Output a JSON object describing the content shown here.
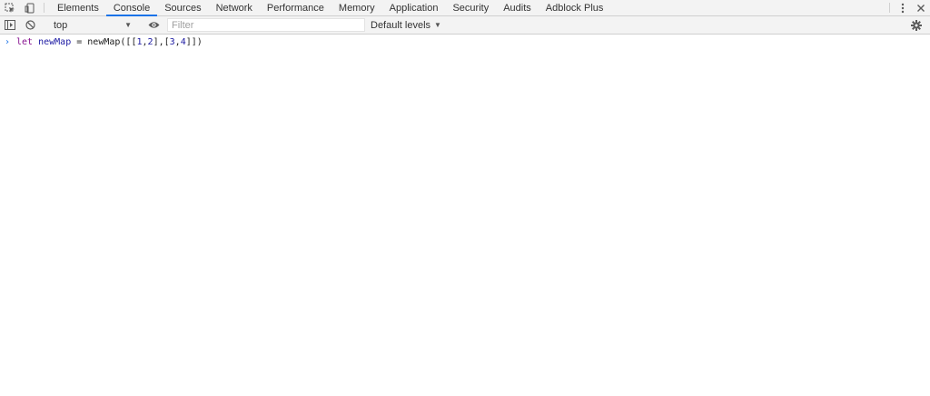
{
  "tabbar": {
    "tabs": [
      {
        "label": "Elements",
        "active": false
      },
      {
        "label": "Console",
        "active": true
      },
      {
        "label": "Sources",
        "active": false
      },
      {
        "label": "Network",
        "active": false
      },
      {
        "label": "Performance",
        "active": false
      },
      {
        "label": "Memory",
        "active": false
      },
      {
        "label": "Application",
        "active": false
      },
      {
        "label": "Security",
        "active": false
      },
      {
        "label": "Audits",
        "active": false
      },
      {
        "label": "Adblock Plus",
        "active": false
      }
    ],
    "icons": [
      "inspect-element-icon",
      "device-toolbar-icon",
      "more-options-icon",
      "close-icon"
    ]
  },
  "toolbar": {
    "context": "top",
    "filter_placeholder": "Filter",
    "filter_value": "",
    "levels_label": "Default levels",
    "icons": [
      "show-sidebar-icon",
      "clear-console-icon",
      "live-expression-eye-icon",
      "settings-gear-icon"
    ]
  },
  "console": {
    "entries": [
      {
        "tokens": [
          {
            "text": "let",
            "kind": "kw"
          },
          {
            "text": " ",
            "kind": "plain"
          },
          {
            "text": "newMap",
            "kind": "ident"
          },
          {
            "text": " = ",
            "kind": "plain"
          },
          {
            "text": "newMap",
            "kind": "plain"
          },
          {
            "text": "([[",
            "kind": "plain"
          },
          {
            "text": "1",
            "kind": "num"
          },
          {
            "text": ",",
            "kind": "plain"
          },
          {
            "text": "2",
            "kind": "num"
          },
          {
            "text": "],[",
            "kind": "plain"
          },
          {
            "text": "3",
            "kind": "num"
          },
          {
            "text": ",",
            "kind": "plain"
          },
          {
            "text": "4",
            "kind": "num"
          },
          {
            "text": "]])",
            "kind": "plain"
          }
        ]
      }
    ]
  },
  "colors": {
    "accent": "#1a73e8",
    "keyword": "#881391",
    "identifier": "#1c1aa3"
  }
}
